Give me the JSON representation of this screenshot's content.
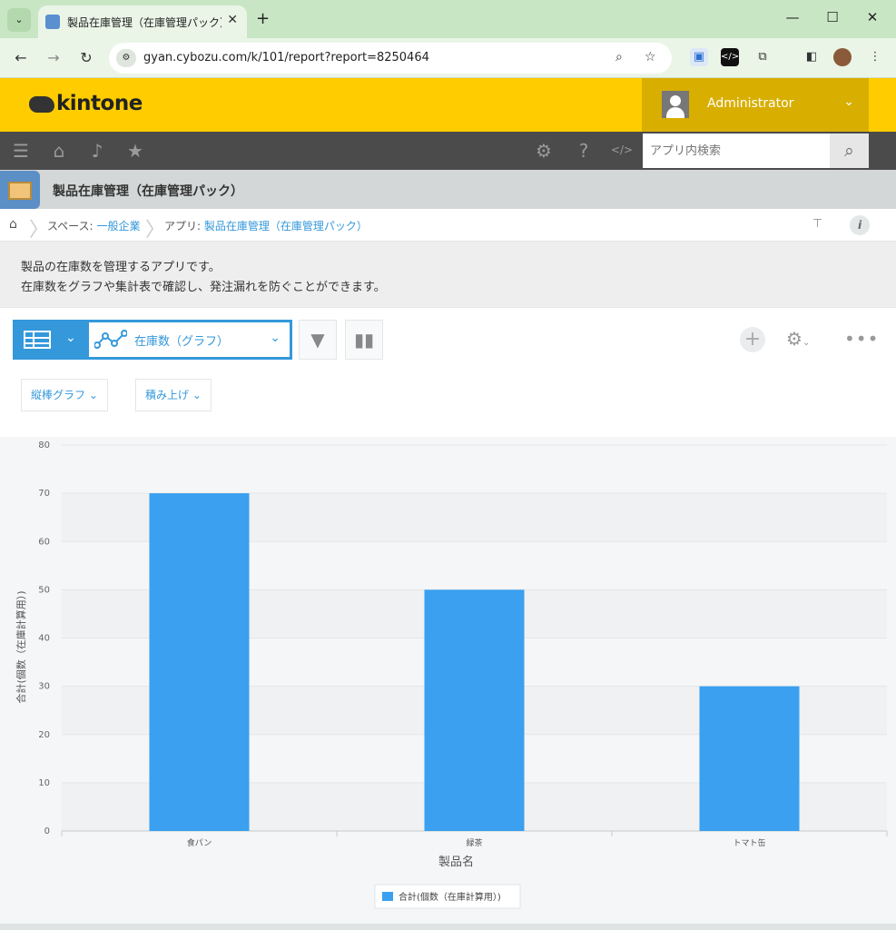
{
  "browser": {
    "tab_title": "製品在庫管理（在庫管理パック）",
    "url": "gyan.cybozu.com/k/101/report?report=8250464"
  },
  "header": {
    "logo": "kintone",
    "user_name": "Administrator"
  },
  "gnav": {
    "search_placeholder": "アプリ内検索"
  },
  "app": {
    "title": "製品在庫管理（在庫管理パック）"
  },
  "breadcrumb": {
    "space_prefix": "スペース:",
    "space_name": "一般企業",
    "app_prefix": "アプリ:",
    "app_name": "製品在庫管理（在庫管理パック）"
  },
  "description": {
    "line1": "製品の在庫数を管理するアプリです。",
    "line2": "在庫数をグラフや集計表で確認し、発注漏れを防ぐことができます。"
  },
  "toolbar": {
    "view_name": "在庫数（グラフ）",
    "chart_type": "縦棒グラフ",
    "stack_mode": "積み上げ"
  },
  "colors": {
    "accent": "#3498db",
    "bar": "#3aa0ef",
    "header": "#ffcc00"
  },
  "chart_data": {
    "type": "bar",
    "categories": [
      "食パン",
      "緑茶",
      "トマト缶"
    ],
    "series": [
      {
        "name": "合計(個数（在庫計算用）)",
        "values": [
          70,
          50,
          30
        ]
      }
    ],
    "xlabel": "製品名",
    "ylabel": "合計(個数（在庫計算用）)",
    "ylim": [
      0,
      80
    ],
    "yticks": [
      0,
      10,
      20,
      30,
      40,
      50,
      60,
      70,
      80
    ],
    "grid": true,
    "legend": "bottom-center"
  }
}
